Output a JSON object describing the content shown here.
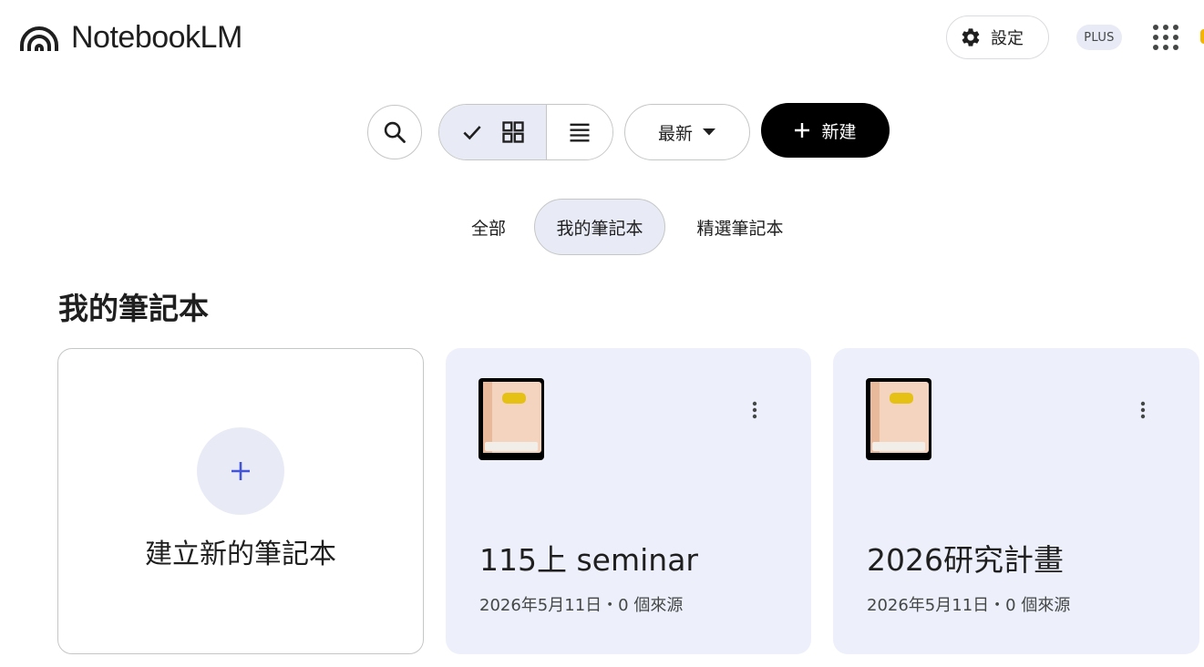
{
  "header": {
    "app_name": "NotebookLM",
    "settings_label": "設定",
    "plan_badge": "PLUS"
  },
  "toolbar": {
    "view_mode": "grid",
    "sort_label": "最新",
    "new_label": "新建"
  },
  "tabs": [
    {
      "label": "全部",
      "selected": false
    },
    {
      "label": "我的筆記本",
      "selected": true
    },
    {
      "label": "精選筆記本",
      "selected": false
    }
  ],
  "section": {
    "title": "我的筆記本",
    "create_label": "建立新的筆記本"
  },
  "notebooks": [
    {
      "icon": "book-emoji-icon",
      "title": "115上 seminar",
      "meta": "2026年5月11日・0 個來源"
    },
    {
      "icon": "book-emoji-icon",
      "title": "2026研究計畫",
      "meta": "2026年5月11日・0 個來源"
    }
  ],
  "colors": {
    "accent": "#4355d6",
    "card_bg": "#edf0fa",
    "selected_bg": "#e8eaf6",
    "primary_button": "#000000"
  }
}
